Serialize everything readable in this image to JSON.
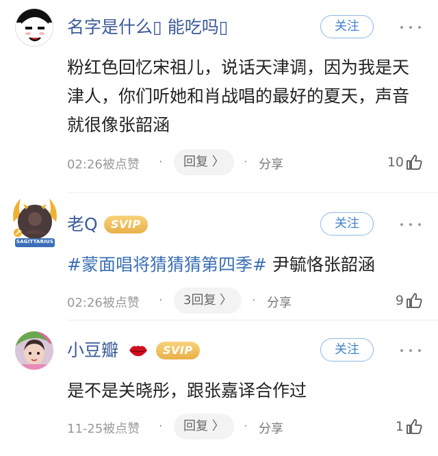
{
  "comments": [
    {
      "username": "名字是什么▯ 能吃吗▯",
      "follow_label": "关注",
      "content": "粉红色回忆宋祖儿，说话天津调，因为我是天津人，你们听她和肖战唱的最好的夏天，声音就很像张韶涵",
      "time": "02:26被点赞",
      "reply_label": "回复 〉",
      "share_label": "分享",
      "likes": "10",
      "avatar_icon": "meme-face-avatar-icon"
    },
    {
      "username": "老Q",
      "vip_label": "SVIP",
      "follow_label": "关注",
      "hashtag": "#蒙面唱将猜猜猜第四季#",
      "content": " 尹毓恪张韶涵",
      "time": "02:26被点赞",
      "reply_label": "3回复 〉",
      "share_label": "分享",
      "likes": "9",
      "avatar_badge": "SAGITTARIUS"
    },
    {
      "username": "小豆瓣",
      "vip_label": "SVIP",
      "follow_label": "关注",
      "content": "是不是关晓彤，跟张嘉译合作过",
      "time": "11-25被点赞",
      "reply_label": "回复 〉",
      "share_label": "分享",
      "likes": "1",
      "avatar_icon": "child-photo-avatar-icon",
      "lips_icon": "red-lips-icon"
    }
  ],
  "colors": {
    "username": "#3a5a99",
    "hashtag": "#3a6fb5",
    "follow_border": "#8eb6e3",
    "vip_gold": "#e8b04a"
  }
}
